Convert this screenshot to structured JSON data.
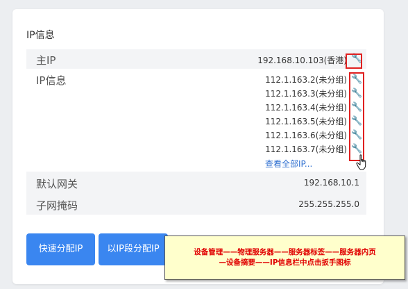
{
  "card": {
    "title": "IP信息"
  },
  "rows": {
    "main_ip": {
      "label": "主IP",
      "value": "192.168.10.103(香港)"
    },
    "ip_info": {
      "label": "IP信息",
      "ips": [
        "112.1.163.2(未分组)",
        "112.1.163.3(未分组)",
        "112.1.163.4(未分组)",
        "112.1.163.5(未分组)",
        "112.1.163.6(未分组)",
        "112.1.163.7(未分组)"
      ],
      "view_all": "查看全部IP..."
    },
    "gateway": {
      "label": "默认网关",
      "value": "192.168.10.1"
    },
    "mask": {
      "label": "子网掩码",
      "value": "255.255.255.0"
    }
  },
  "buttons": {
    "quick_assign": "快速分配IP",
    "range_assign": "以IP段分配IP"
  },
  "tooltip": {
    "line1": "设备管理——物理服务器——服务器标签——服务器内页",
    "line2": "—设备摘要——IP信息栏中点击扳手图标"
  },
  "icons": {
    "wrench": "wrench-icon",
    "cursor": "hand-pointer-icon"
  },
  "colors": {
    "accent": "#3a86f0",
    "link": "#2f6fd0",
    "highlight_border": "#e02020",
    "tooltip_bg": "#ffffcc",
    "tooltip_text": "#e00000"
  }
}
